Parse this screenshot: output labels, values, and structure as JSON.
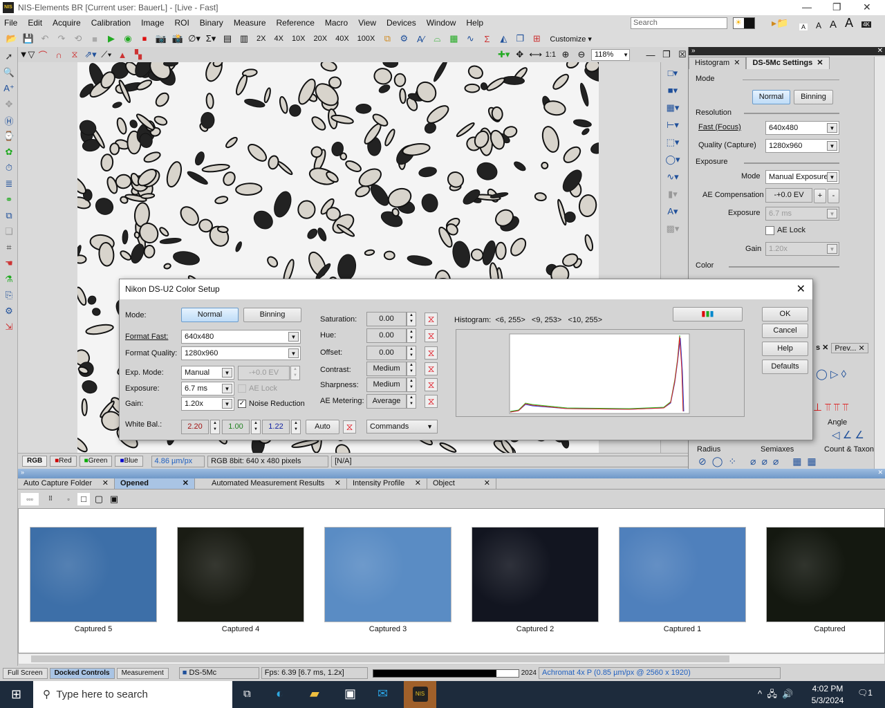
{
  "window": {
    "title": "NIS-Elements BR [Current user: BauerL]  - [Live - Fast]",
    "logo": "NIS"
  },
  "menu": [
    "File",
    "Edit",
    "Acquire",
    "Calibration",
    "Image",
    "ROI",
    "Binary",
    "Measure",
    "Reference",
    "Macro",
    "View",
    "Devices",
    "Window",
    "Help"
  ],
  "search": {
    "placeholder": "Search"
  },
  "toolbar": {
    "magnifications": [
      "2X",
      "4X",
      "10X",
      "20X",
      "40X",
      "100X"
    ],
    "customize": "Customize",
    "font_sizes": [
      "A",
      "A",
      "A",
      "A"
    ],
    "badge_4k": "4K"
  },
  "image_toolbar": {
    "ratio": "1:1",
    "zoom": "118%"
  },
  "image_status": {
    "channels": [
      "RGB",
      "Red",
      "Green",
      "Blue"
    ],
    "calibration": "4.86 µm/px",
    "format": "RGB 8bit: 640 x 480 pixels",
    "value": "[N/A]"
  },
  "right_panel": {
    "tabs": [
      "Histogram",
      "DS-5Mc Settings"
    ],
    "mode_label": "Mode",
    "mode_buttons": [
      "Normal",
      "Binning"
    ],
    "resolution_label": "Resolution",
    "fast_label": "Fast (Focus)",
    "fast_value": "640x480",
    "quality_label": "Quality (Capture)",
    "quality_value": "1280x960",
    "exposure_label": "Exposure",
    "exp_mode_label": "Mode",
    "exp_mode_value": "Manual Exposure",
    "ae_comp_label": "AE Compensation",
    "ae_comp_value": "-+0.0 EV",
    "plus": "+",
    "minus": "-",
    "exposure_field_label": "Exposure",
    "exposure_value": "6.7 ms",
    "ae_lock": "AE Lock",
    "gain_label": "Gain",
    "gain_value": "1.20x",
    "color_label": "Color",
    "lower_tabs": [
      "s",
      "Prev..."
    ],
    "angle": "Angle",
    "radius": "Radius",
    "semiaxes": "Semiaxes",
    "count": "Count & Taxon"
  },
  "dialog": {
    "title": "Nikon DS-U2 Color Setup",
    "mode_label": "Mode:",
    "mode_buttons": [
      "Normal",
      "Binning"
    ],
    "format_fast_label": "Format Fast:",
    "format_fast": "640x480",
    "format_quality_label": "Format Quality:",
    "format_quality": "1280x960",
    "exp_mode_label": "Exp. Mode:",
    "exp_mode": "Manual",
    "ev": "-+0.0 EV",
    "exposure_label": "Exposure:",
    "exposure": "6.7 ms",
    "ae_lock": "AE Lock",
    "gain_label": "Gain:",
    "gain": "1.20x",
    "noise_reduction": "Noise Reduction",
    "noise_reduction_checked": true,
    "white_bal_label": "White Bal.:",
    "wb": [
      "2.20",
      "1.00",
      "1.22"
    ],
    "wb_colors": [
      "#a01010",
      "#208020",
      "#1020a0"
    ],
    "auto": "Auto",
    "params": [
      {
        "label": "Saturation:",
        "value": "0.00"
      },
      {
        "label": "Hue:",
        "value": "0.00"
      },
      {
        "label": "Offset:",
        "value": "0.00"
      },
      {
        "label": "Contrast:",
        "value": "Medium"
      },
      {
        "label": "Sharpness:",
        "value": "Medium"
      },
      {
        "label": "AE Metering:",
        "value": "Average"
      }
    ],
    "commands": "Commands",
    "histogram_label": "Histogram:",
    "histogram_ranges": [
      "<6, 255>",
      "<9, 253>",
      "<10, 255>"
    ],
    "buttons": [
      "OK",
      "Cancel",
      "Help",
      "Defaults"
    ]
  },
  "bottom": {
    "tabs": [
      "Auto Capture Folder",
      "Opened Images",
      "Automated Measurement Results",
      "Intensity Profile",
      "Object Count"
    ],
    "thumbnails": [
      {
        "label": "Captured 5",
        "bg": "#3d6fa8"
      },
      {
        "label": "Captured 4",
        "bg": "#1a1c14"
      },
      {
        "label": "Captured 3",
        "bg": "#5a8cc4"
      },
      {
        "label": "Captured 2",
        "bg": "#121520"
      },
      {
        "label": "Captured 1",
        "bg": "#4f80bc"
      },
      {
        "label": "Captured",
        "bg": "#141810"
      }
    ]
  },
  "statusbar": {
    "tabs": [
      "Full Screen",
      "Docked Controls",
      "Measurement"
    ],
    "camera": "DS-5Mc",
    "fps": "Fps: 6.39 [6.7 ms, 1.2x]",
    "progress_text": "2024",
    "progress": 0.85,
    "objective": "Achromat 4x P (0.85 µm/px @ 2560 x 1920)"
  },
  "taskbar": {
    "search_placeholder": "Type here to search",
    "time": "4:02 PM",
    "date": "5/3/2024",
    "notifications": "1"
  }
}
